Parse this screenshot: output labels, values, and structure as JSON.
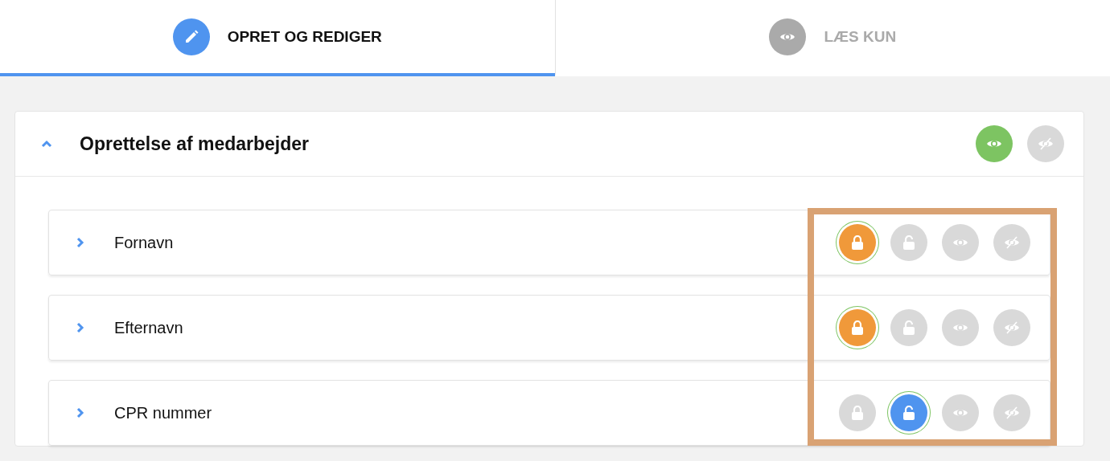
{
  "tabs": [
    {
      "label": "OPRET OG REDIGER",
      "kind": "edit",
      "selected": true
    },
    {
      "label": "LÆS KUN",
      "kind": "view",
      "selected": false
    }
  ],
  "section": {
    "title": "Oprettelse af medarbejder",
    "expanded": true,
    "actions": [
      {
        "kind": "show",
        "selected": true
      },
      {
        "kind": "hide",
        "selected": false
      }
    ],
    "actions_highlighted": true,
    "fields": [
      {
        "label": "Fornavn",
        "expanded": false,
        "actions": [
          {
            "kind": "lock",
            "selected": true
          },
          {
            "kind": "unlock",
            "selected": false
          },
          {
            "kind": "show",
            "selected": false
          },
          {
            "kind": "hide",
            "selected": false
          }
        ]
      },
      {
        "label": "Efternavn",
        "expanded": false,
        "actions": [
          {
            "kind": "lock",
            "selected": true
          },
          {
            "kind": "unlock",
            "selected": false
          },
          {
            "kind": "show",
            "selected": false
          },
          {
            "kind": "hide",
            "selected": false
          }
        ]
      },
      {
        "label": "CPR nummer",
        "expanded": false,
        "actions": [
          {
            "kind": "lock",
            "selected": false
          },
          {
            "kind": "unlock",
            "selected": true
          },
          {
            "kind": "show",
            "selected": false
          },
          {
            "kind": "hide",
            "selected": false
          }
        ]
      }
    ]
  }
}
